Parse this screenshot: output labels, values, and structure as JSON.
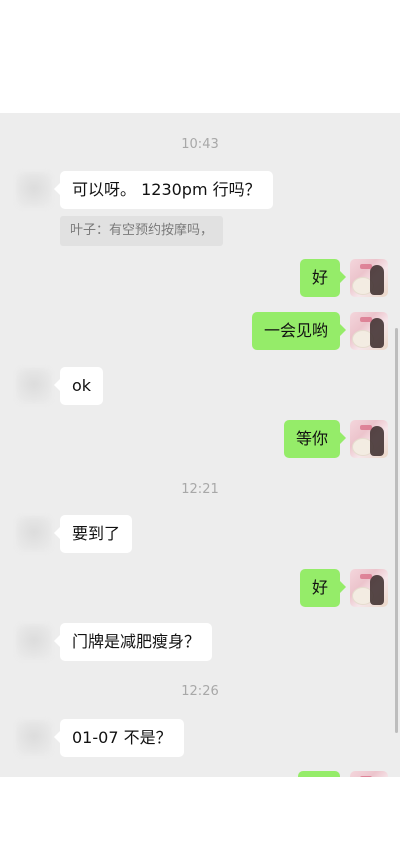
{
  "colors": {
    "chat_background": "#ededed",
    "incoming_bubble": "#ffffff",
    "outgoing_bubble": "#95ec69",
    "timestamp_text": "#a8a8a8",
    "quote_background": "#e1e1e1"
  },
  "timestamps": [
    "10:43",
    "12:21",
    "12:26"
  ],
  "messages": [
    {
      "side": "left",
      "text": "可以呀。 1230pm 行吗？"
    },
    {
      "side": "left",
      "type": "quote",
      "text": "叶子：有空预约按摩吗，"
    },
    {
      "side": "right",
      "text": "好"
    },
    {
      "side": "right",
      "text": "一会见哟"
    },
    {
      "side": "left",
      "text": "ok"
    },
    {
      "side": "right",
      "text": "等你"
    },
    {
      "side": "left",
      "text": "要到了"
    },
    {
      "side": "right",
      "text": "好"
    },
    {
      "side": "left",
      "text": "门牌是减肥瘦身？"
    },
    {
      "side": "left",
      "text": "01-07 不是？"
    },
    {
      "side": "right",
      "text": ""
    }
  ],
  "icons": {
    "incoming_avatar": "blurred-avatar-icon",
    "outgoing_avatar": "profile-photo-avatar"
  }
}
